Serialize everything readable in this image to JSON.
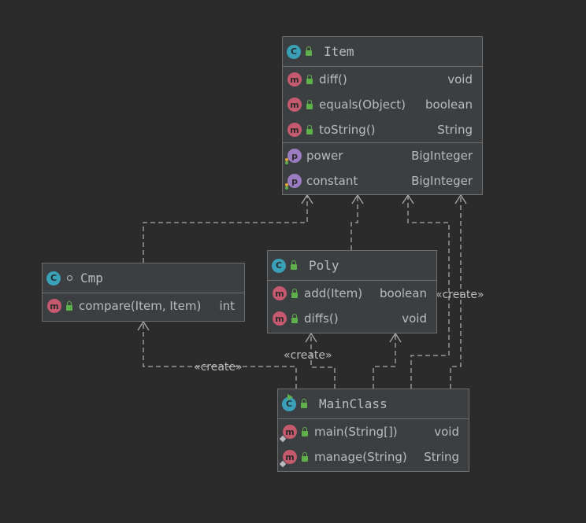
{
  "classes": {
    "item": {
      "name": "Item",
      "methods": [
        {
          "name": "diff()",
          "type": "void"
        },
        {
          "name": "equals(Object)",
          "type": "boolean"
        },
        {
          "name": "toString()",
          "type": "String"
        }
      ],
      "properties": [
        {
          "name": "power",
          "type": "BigInteger"
        },
        {
          "name": "constant",
          "type": "BigInteger"
        }
      ]
    },
    "cmp": {
      "name": "Cmp",
      "methods": [
        {
          "name": "compare(Item, Item)",
          "type": "int"
        }
      ]
    },
    "poly": {
      "name": "Poly",
      "methods": [
        {
          "name": "add(Item)",
          "type": "boolean"
        },
        {
          "name": "diffs()",
          "type": "void"
        }
      ]
    },
    "mainclass": {
      "name": "MainClass",
      "methods": [
        {
          "name": "main(String[])",
          "type": "void"
        },
        {
          "name": "manage(String)",
          "type": "String"
        }
      ]
    }
  },
  "edge_labels": {
    "create_cmp": "«create»",
    "create_poly": "«create»",
    "create_item": "«create»"
  },
  "icons": {
    "class": "C",
    "method": "m",
    "property": "p"
  },
  "colors": {
    "background": "#2b2b2b",
    "box": "#3c3f41",
    "class_icon": "#3aa0b7",
    "method_icon": "#c55a6e",
    "property_icon": "#9b7cc0",
    "public_lock": "#5fb04b"
  }
}
